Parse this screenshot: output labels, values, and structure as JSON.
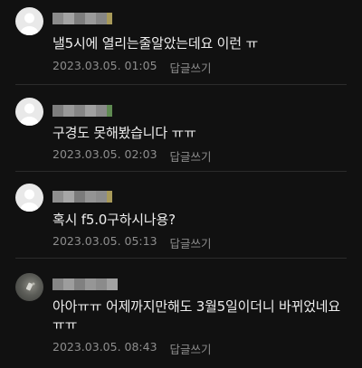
{
  "comments": [
    {
      "text": "낼5시에 열리는줄알았는데요 이런 ㅠ",
      "date": "2023.03.05. 01:05",
      "reply_label": "답글쓰기",
      "avatar": "default-profile-icon"
    },
    {
      "text": "구경도 못해봤습니다 ㅠㅠ",
      "date": "2023.03.05. 02:03",
      "reply_label": "답글쓰기",
      "avatar": "default-profile-icon"
    },
    {
      "text": "혹시 f5.0구하시나용?",
      "date": "2023.03.05. 05:13",
      "reply_label": "답글쓰기",
      "avatar": "default-profile-icon"
    },
    {
      "text": "아아ㅠㅠ 어제까지만해도 3월5일이더니 바뀌었네요ㅠㅠ",
      "date": "2023.03.05. 08:43",
      "reply_label": "답글쓰기",
      "avatar": "photo-profile"
    }
  ],
  "colors": {
    "background": "#111111",
    "text": "#ededed",
    "meta": "#8d8d8d",
    "divider": "#2b2b2b"
  }
}
